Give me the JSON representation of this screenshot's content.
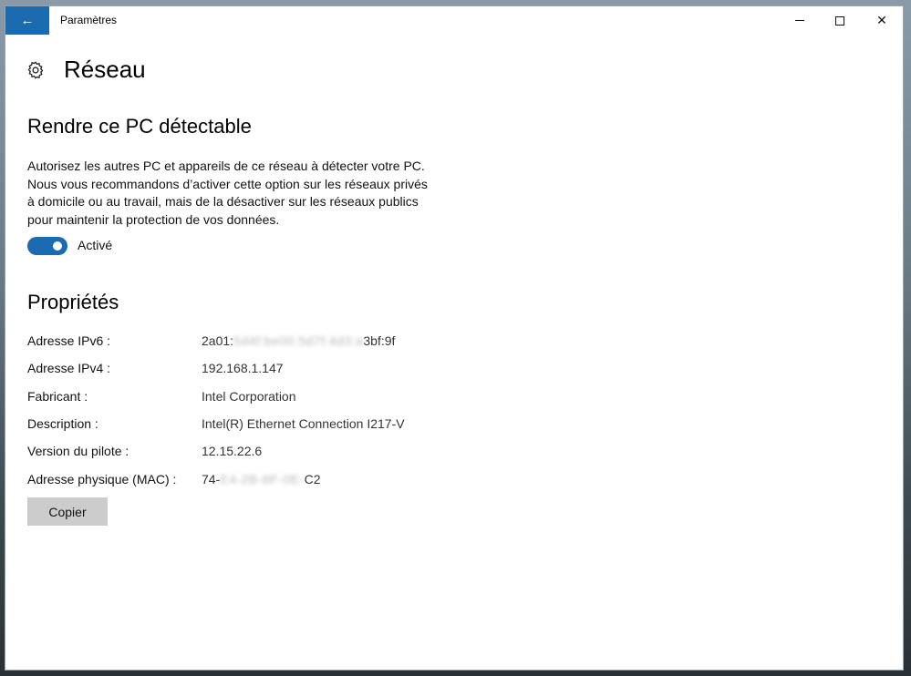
{
  "titlebar": {
    "back_glyph": "←",
    "title": "Paramètres",
    "close_glyph": "✕"
  },
  "page": {
    "title": "Réseau"
  },
  "discoverable": {
    "heading": "Rendre ce PC détectable",
    "description": "Autorisez les autres PC et appareils de ce réseau à détecter votre PC. Nous vous recommandons d’activer cette option sur les réseaux privés à domicile ou au travail, mais de la désactiver sur les réseaux publics pour maintenir la protection de vos données.",
    "toggle_state": "Activé",
    "toggle_on": true
  },
  "properties": {
    "heading": "Propriétés",
    "rows": [
      {
        "label": "Adresse IPv6 :",
        "prefix": "2a01:",
        "hidden": "5d4f:be00:5d7f:4d3:a",
        "suffix": "3bf:9f"
      },
      {
        "label": "Adresse IPv4 :",
        "value": "192.168.1.147"
      },
      {
        "label": "Fabricant :",
        "value": "Intel Corporation"
      },
      {
        "label": "Description :",
        "value": "Intel(R) Ethernet Connection I217-V"
      },
      {
        "label": "Version du pilote :",
        "value": "12.15.22.6"
      },
      {
        "label": "Adresse physique (MAC) :",
        "prefix": "74-",
        "hidden": "E4-2B-8F-0E-",
        "suffix": "C2"
      }
    ],
    "copy_label": "Copier"
  },
  "colors": {
    "accent": "#1b6bb0",
    "button_gray": "#cccccc"
  },
  "icons": {
    "back": "back-arrow-icon",
    "settings": "gear-icon",
    "minimize": "minimize-icon",
    "maximize": "maximize-icon",
    "close": "close-icon"
  }
}
